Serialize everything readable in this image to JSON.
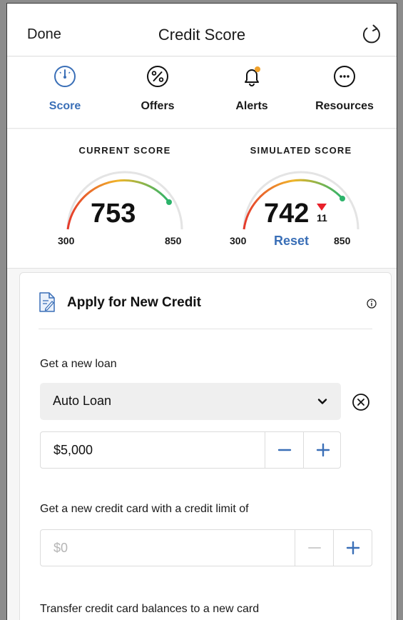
{
  "topbar": {
    "done_label": "Done",
    "title": "Credit Score",
    "refresh_icon": "refresh-icon"
  },
  "tabs": [
    {
      "label": "Score",
      "icon": "gauge-icon",
      "active": true
    },
    {
      "label": "Offers",
      "icon": "percent-icon",
      "active": false
    },
    {
      "label": "Alerts",
      "icon": "bell-icon",
      "active": false
    },
    {
      "label": "Resources",
      "icon": "more-icon",
      "active": false
    }
  ],
  "current_score": {
    "heading": "CURRENT SCORE",
    "value": "753",
    "min": "300",
    "max": "850"
  },
  "simulated_score": {
    "heading": "SIMULATED SCORE",
    "value": "742",
    "change": "11",
    "min": "300",
    "max": "850",
    "reset_label": "Reset"
  },
  "apply_card": {
    "title": "Apply for New Credit",
    "loan": {
      "label": "Get a new loan",
      "type_value": "Auto Loan",
      "amount_value": "$5,000"
    },
    "credit_card": {
      "label": "Get a new credit card with a credit limit of",
      "placeholder": "$0"
    },
    "transfer": {
      "label": "Transfer credit card balances to a new card"
    }
  },
  "colors": {
    "accent": "#3a6fb7",
    "decrease": "#e8202a",
    "gauge_start": "#e53a2c",
    "gauge_mid": "#f0b52a",
    "gauge_end": "#2bb36a"
  }
}
